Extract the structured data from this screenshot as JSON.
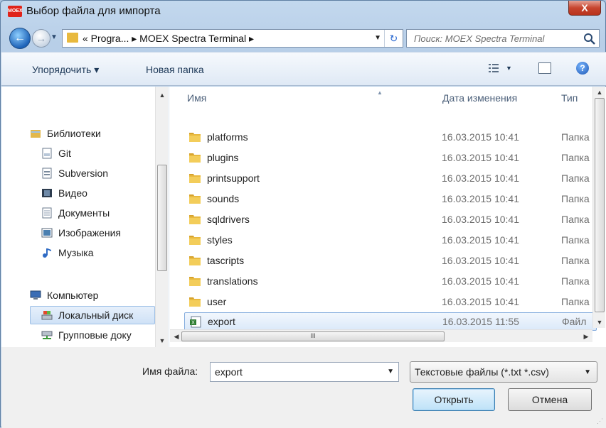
{
  "window": {
    "title": "Выбор файла для импорта",
    "close_label": "X",
    "app_icon_label": "MOEX"
  },
  "address_bar": {
    "path": "« Progra... ▸ MOEX Spectra Terminal ▸",
    "search_placeholder": "Поиск: MOEX Spectra Terminal"
  },
  "toolbar": {
    "organize_label": "Упорядочить ▾",
    "new_folder_label": "Новая папка"
  },
  "nav": {
    "items": [
      {
        "label": "Библиотеки",
        "icon": "libraries-icon"
      },
      {
        "label": "Git",
        "icon": "git-library-icon"
      },
      {
        "label": "Subversion",
        "icon": "subversion-library-icon"
      },
      {
        "label": "Видео",
        "icon": "video-icon"
      },
      {
        "label": "Документы",
        "icon": "documents-icon"
      },
      {
        "label": "Изображения",
        "icon": "pictures-icon"
      },
      {
        "label": "Музыка",
        "icon": "music-icon"
      },
      {
        "label": "Компьютер",
        "icon": "computer-icon"
      },
      {
        "label": "Локальный диск",
        "icon": "local-disk-icon"
      },
      {
        "label": "Групповые доку",
        "icon": "network-drive-icon"
      }
    ]
  },
  "files": {
    "columns": {
      "name": "Имя",
      "date": "Дата изменения",
      "type": "Тип"
    },
    "rows": [
      {
        "name": "platforms",
        "date": "16.03.2015 10:41",
        "type": "Папка"
      },
      {
        "name": "plugins",
        "date": "16.03.2015 10:41",
        "type": "Папка"
      },
      {
        "name": "printsupport",
        "date": "16.03.2015 10:41",
        "type": "Папка"
      },
      {
        "name": "sounds",
        "date": "16.03.2015 10:41",
        "type": "Папка"
      },
      {
        "name": "sqldrivers",
        "date": "16.03.2015 10:41",
        "type": "Папка"
      },
      {
        "name": "styles",
        "date": "16.03.2015 10:41",
        "type": "Папка"
      },
      {
        "name": "tascripts",
        "date": "16.03.2015 10:41",
        "type": "Папка"
      },
      {
        "name": "translations",
        "date": "16.03.2015 10:41",
        "type": "Папка"
      },
      {
        "name": "user",
        "date": "16.03.2015 10:41",
        "type": "Папка"
      },
      {
        "name": "export",
        "date": "16.03.2015 11:55",
        "type": "Файл"
      }
    ]
  },
  "bottom": {
    "filename_label": "Имя файла:",
    "filename_value": "export",
    "filter_value": "Текстовые файлы (*.txt *.csv)",
    "open_label": "Открыть",
    "cancel_label": "Отмена"
  }
}
